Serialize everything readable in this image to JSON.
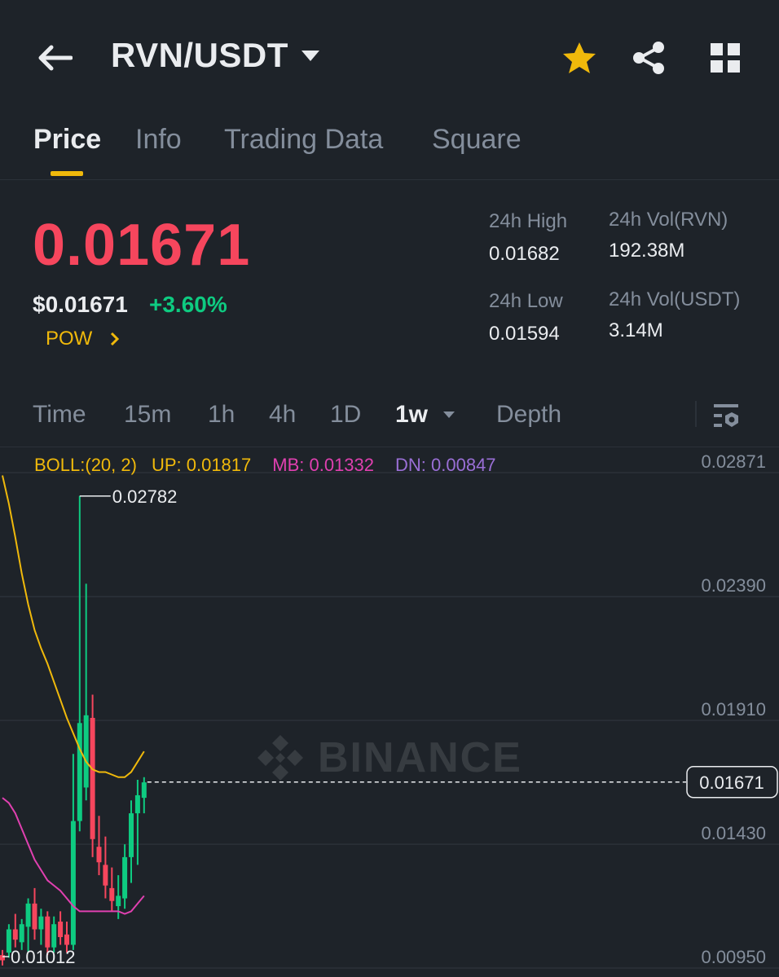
{
  "header": {
    "pair": "RVN/USDT",
    "icons": {
      "back": "arrow-left-icon",
      "dropdown": "caret-down-icon",
      "favorite": "star-icon",
      "share": "share-icon",
      "more": "grid-icon"
    }
  },
  "tabs": [
    {
      "label": "Price",
      "active": true
    },
    {
      "label": "Info",
      "active": false
    },
    {
      "label": "Trading Data",
      "active": false
    },
    {
      "label": "Square",
      "active": false
    }
  ],
  "price": {
    "last": "0.01671",
    "usd": "$0.01671",
    "change": "+3.60%",
    "tag": "POW"
  },
  "stats": {
    "high_label": "24h High",
    "high_value": "0.01682",
    "low_label": "24h Low",
    "low_value": "0.01594",
    "vol_base_label": "24h Vol(RVN)",
    "vol_base_value": "192.38M",
    "vol_quote_label": "24h Vol(USDT)",
    "vol_quote_value": "3.14M"
  },
  "intervals": [
    {
      "label": "Time",
      "active": false
    },
    {
      "label": "15m",
      "active": false
    },
    {
      "label": "1h",
      "active": false
    },
    {
      "label": "4h",
      "active": false
    },
    {
      "label": "1D",
      "active": false
    },
    {
      "label": "1w",
      "active": true
    },
    {
      "label": "Depth",
      "active": false
    }
  ],
  "boll": {
    "name": "BOLL:(20, 2)",
    "up": "UP: 0.01817",
    "mb": "MB: 0.01332",
    "dn": "DN: 0.00847"
  },
  "watermark": "BINANCE",
  "colors": {
    "background": "#1e2329",
    "up": "#0ecb81",
    "down": "#f6465d",
    "accent": "#f0b90b",
    "boll_up": "#f0b90b",
    "boll_mb": "#e040b0",
    "boll_dn": "#9a6fd6",
    "text_primary": "#eaecef",
    "text_secondary": "#848e9c"
  },
  "chart_data": {
    "type": "candlestick",
    "y_ticks": [
      "0.02871",
      "0.02390",
      "0.01910",
      "0.01430",
      "0.00950"
    ],
    "ylim": [
      0.0095,
      0.02871
    ],
    "grid": true,
    "last_price_label": "0.01671",
    "last_price": 0.01671,
    "max_label": "0.02782",
    "min_label": "0.01012",
    "candles": [
      {
        "o": 0.01,
        "h": 0.0102,
        "l": 0.0096,
        "c": 0.0098
      },
      {
        "o": 0.0101,
        "h": 0.0112,
        "l": 0.0099,
        "c": 0.011
      },
      {
        "o": 0.011,
        "h": 0.0116,
        "l": 0.0103,
        "c": 0.0106
      },
      {
        "o": 0.0105,
        "h": 0.0114,
        "l": 0.0102,
        "c": 0.0112
      },
      {
        "o": 0.0111,
        "h": 0.0122,
        "l": 0.0101,
        "c": 0.012
      },
      {
        "o": 0.012,
        "h": 0.0126,
        "l": 0.0106,
        "c": 0.011
      },
      {
        "o": 0.011,
        "h": 0.0118,
        "l": 0.0104,
        "c": 0.0115
      },
      {
        "o": 0.0115,
        "h": 0.0117,
        "l": 0.01,
        "c": 0.0103
      },
      {
        "o": 0.0103,
        "h": 0.0115,
        "l": 0.0101,
        "c": 0.0112
      },
      {
        "o": 0.0113,
        "h": 0.0117,
        "l": 0.0104,
        "c": 0.0107
      },
      {
        "o": 0.0108,
        "h": 0.0113,
        "l": 0.0101,
        "c": 0.0104
      },
      {
        "o": 0.0104,
        "h": 0.0178,
        "l": 0.0102,
        "c": 0.0152
      },
      {
        "o": 0.0152,
        "h": 0.0278,
        "l": 0.0148,
        "c": 0.019
      },
      {
        "o": 0.0165,
        "h": 0.0244,
        "l": 0.016,
        "c": 0.0193
      },
      {
        "o": 0.0192,
        "h": 0.0201,
        "l": 0.0138,
        "c": 0.0145
      },
      {
        "o": 0.0142,
        "h": 0.0154,
        "l": 0.0131,
        "c": 0.0136
      },
      {
        "o": 0.0135,
        "h": 0.0146,
        "l": 0.0122,
        "c": 0.0127
      },
      {
        "o": 0.0126,
        "h": 0.0134,
        "l": 0.0117,
        "c": 0.0121
      },
      {
        "o": 0.0119,
        "h": 0.0131,
        "l": 0.0114,
        "c": 0.0123
      },
      {
        "o": 0.0122,
        "h": 0.0143,
        "l": 0.0118,
        "c": 0.0138
      },
      {
        "o": 0.0138,
        "h": 0.016,
        "l": 0.0128,
        "c": 0.0155
      },
      {
        "o": 0.0155,
        "h": 0.0168,
        "l": 0.0135,
        "c": 0.0162
      },
      {
        "o": 0.0161,
        "h": 0.0169,
        "l": 0.0155,
        "c": 0.0167
      }
    ],
    "boll_up": [
      0.0286,
      0.0275,
      0.0262,
      0.0248,
      0.0236,
      0.0226,
      0.0219,
      0.0213,
      0.0206,
      0.0199,
      0.0192,
      0.0186,
      0.018,
      0.0175,
      0.0172,
      0.0171,
      0.0171,
      0.017,
      0.0169,
      0.0169,
      0.0171,
      0.0175,
      0.0179
    ],
    "boll_mb": [
      0.0161,
      0.0159,
      0.0155,
      0.0149,
      0.0143,
      0.0137,
      0.0133,
      0.0129,
      0.0127,
      0.0125,
      0.0122,
      0.0119,
      0.0117,
      0.0117,
      0.0117,
      0.0117,
      0.0117,
      0.0117,
      0.0117,
      0.0116,
      0.0117,
      0.012,
      0.0123
    ]
  }
}
